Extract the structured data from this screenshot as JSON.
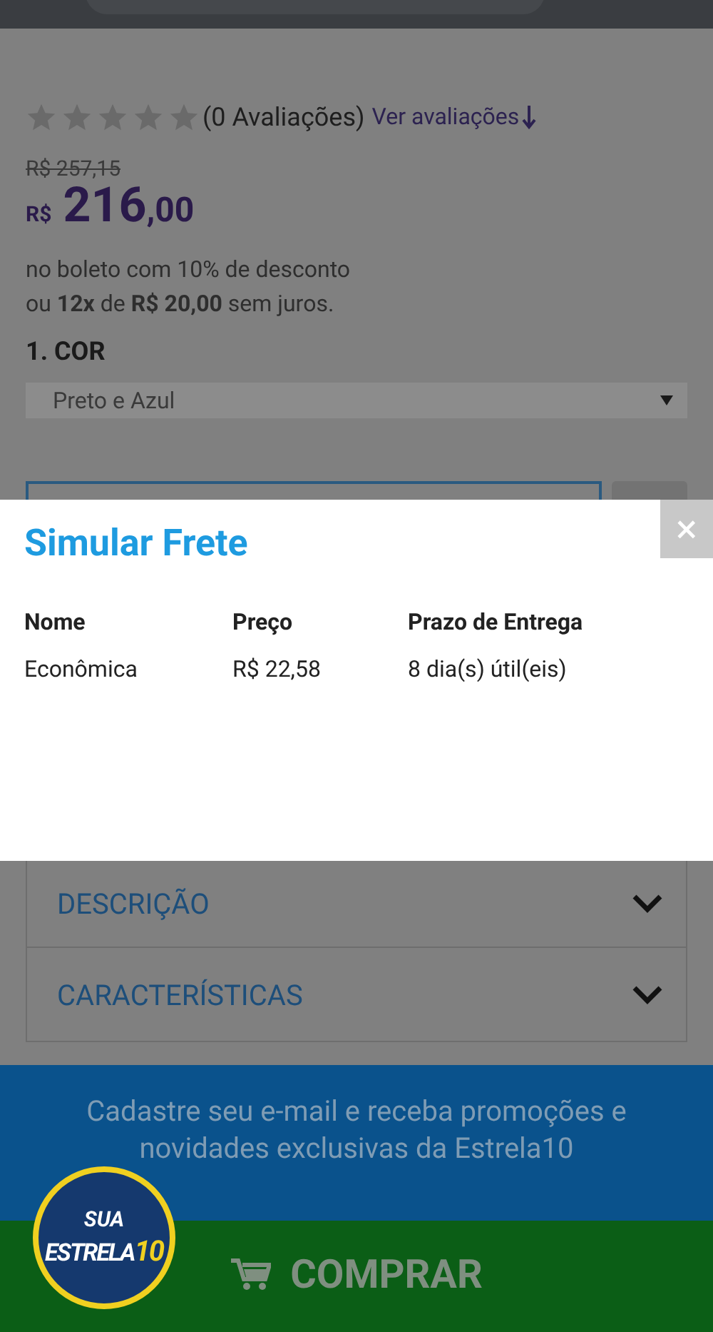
{
  "rating": {
    "stars": 0,
    "count_label": "(0 Avaliações)",
    "link": "Ver avaliações"
  },
  "price": {
    "old": "R$ 257,15",
    "currency": "R$",
    "integer": "216",
    "decimals": ",00",
    "boleto_note": "no boleto com 10% de desconto",
    "installments": "ou **12x** de **R$ 20,00** sem juros."
  },
  "option": {
    "title": "1. COR",
    "value": "Preto e Azul"
  },
  "modal": {
    "title": "Simular Frete",
    "close": "×",
    "columns": [
      "Nome",
      "Preço",
      "Prazo de Entrega"
    ],
    "rows": [
      [
        "Econômica",
        "R$ 22,58",
        "8 dia(s) útil(eis)"
      ]
    ]
  },
  "accordion": [
    {
      "label": "DESCRIÇÃO",
      "expanded": false
    },
    {
      "label": "CARACTERÍSTICAS",
      "expanded": false
    }
  ],
  "newsletter": {
    "text": "Cadastre seu e-mail e receba promoções e novidades exclusivas da Estrela10"
  },
  "badge": {
    "line1": "SUA",
    "line2": "ESTRELA",
    "line3": "10"
  },
  "buy_button": "COMPRAR"
}
